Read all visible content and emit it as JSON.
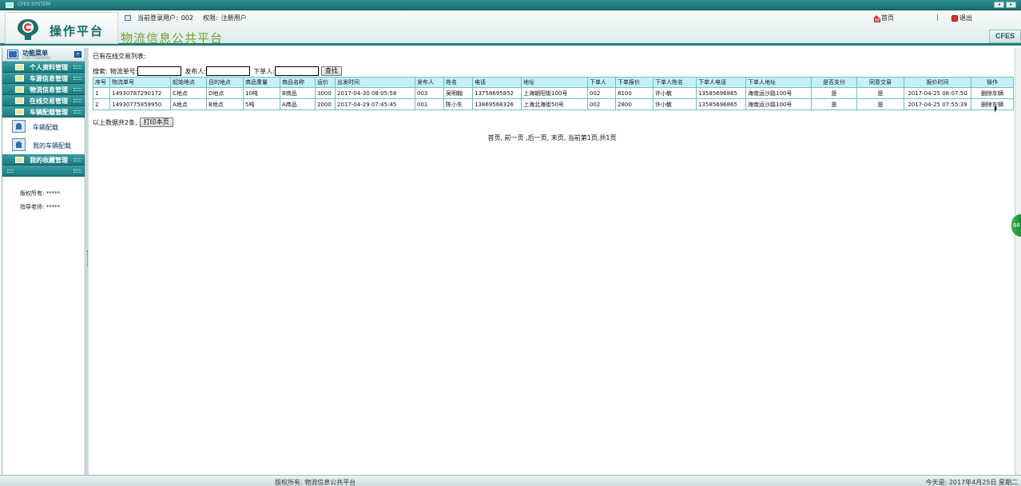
{
  "window": {
    "title": "CFES SYSTEM"
  },
  "header": {
    "logo_text": "操作平台",
    "current_user_label": "当前登录用户:",
    "current_user": "002",
    "permission_label": "权限:",
    "permission": "注册用户",
    "title": "物流信息公共平台",
    "home_label": "首页",
    "separator": "|",
    "exit_label": "退出",
    "brand": "CFES"
  },
  "sidebar": {
    "title": "功能菜单",
    "subtitle": "FUNCTIONMENU",
    "items": [
      {
        "label": "个人资料管理"
      },
      {
        "label": "车源信息管理"
      },
      {
        "label": "物流信息管理"
      },
      {
        "label": "在线交易管理"
      },
      {
        "label": "车辆配载管理"
      }
    ],
    "subitems": [
      {
        "label": "车辆配载"
      },
      {
        "label": "我的车辆配载"
      }
    ],
    "bottom_item": {
      "label": "我的收藏管理"
    },
    "footer": {
      "copyright": "版权所有: *****",
      "advisor": "指导老师: *****"
    }
  },
  "main": {
    "heading": "已有在线交易列表:",
    "search": {
      "label": "搜索:",
      "field1_label": "物流单号:",
      "field1_value": "",
      "field2_label": "发布人:",
      "field2_value": "",
      "field3_label": "下单人:",
      "field3_value": "",
      "button": "查找"
    },
    "table": {
      "columns": [
        "序号",
        "物流单号",
        "起始地点",
        "目的地点",
        "商品重量",
        "商品名称",
        "运价",
        "出发时间",
        "发布人",
        "姓名",
        "电话",
        "地址",
        "下单人",
        "下单报价",
        "下单人姓名",
        "下单人电话",
        "下单人地址",
        "是否支付",
        "同意交易",
        "报价时间",
        "操作"
      ],
      "rows": [
        [
          "1",
          "1493078729017​2",
          "C地点",
          "D地点",
          "10吨",
          "B商品",
          "3000",
          "2017-04-30 08:05:58",
          "003",
          "吴明翰",
          "13758695852",
          "上海朝阳街100号",
          "002",
          "8100",
          "许小敏",
          "13585696865",
          "海南运沙路100号",
          "是",
          "是",
          "2017-04-25 08:07:50",
          "删除车辆"
        ],
        [
          "2",
          "14930775859950",
          "A地点",
          "B地点",
          "5吨",
          "A商品",
          "2000",
          "2017-04-29 07:45:45",
          "001",
          "陈小东",
          "13869568326",
          "上海北海街50号",
          "002",
          "2800",
          "许小敏",
          "13585696865",
          "海南运沙路100号",
          "是",
          "是",
          "2017-04-25 07:55:39",
          "删除车辆"
        ]
      ]
    },
    "summary_text": "以上数据共2条,",
    "print_button": "打印本页",
    "pager": "首页, 前一页 ,后一页, 末页, 当前第1页,共1页"
  },
  "floating_badge": "66",
  "statusbar": {
    "center": "版权所有: 物流信息公共平台",
    "right": "今天是: 2017年4月25日 星期二"
  }
}
